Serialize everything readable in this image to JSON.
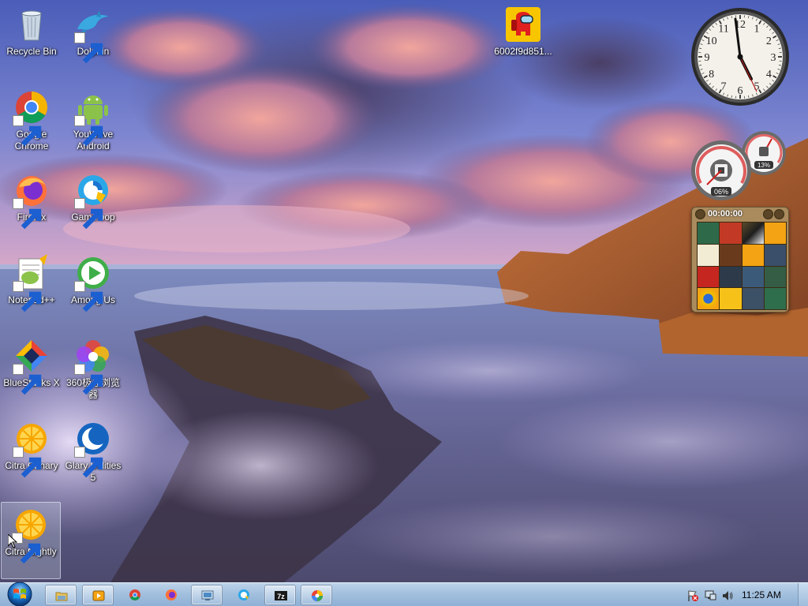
{
  "desktop": {
    "icons": [
      {
        "label": "Recycle Bin",
        "icon": "recycle-bin-icon",
        "shortcut": false
      },
      {
        "label": "Dolphin",
        "icon": "dolphin-icon",
        "shortcut": true
      },
      {
        "label": "6002f9d851...",
        "icon": "among-us-crewmate-icon",
        "shortcut": false
      },
      {
        "label": "Google Chrome",
        "icon": "chrome-icon",
        "shortcut": true
      },
      {
        "label": "YouWave Android",
        "icon": "android-icon",
        "shortcut": true
      },
      {
        "label": "Firefox",
        "icon": "firefox-icon",
        "shortcut": true
      },
      {
        "label": "Gameloop",
        "icon": "gameloop-icon",
        "shortcut": true
      },
      {
        "label": "Notepad++",
        "icon": "notepadpp-icon",
        "shortcut": true
      },
      {
        "label": "Among Us",
        "icon": "among-us-icon",
        "shortcut": true
      },
      {
        "label": "BlueStacks X",
        "icon": "bluestacks-icon",
        "shortcut": true
      },
      {
        "label": "360极速浏览器",
        "icon": "browser-360-icon",
        "shortcut": true
      },
      {
        "label": "Citra Canary",
        "icon": "citra-icon",
        "shortcut": true
      },
      {
        "label": "Glary Utilities 5",
        "icon": "glary-icon",
        "shortcut": true
      },
      {
        "label": "Citra Nightly",
        "icon": "citra-icon",
        "shortcut": true,
        "selected": true
      }
    ]
  },
  "gadgets": {
    "clock": {
      "hour_numerals": [
        "12",
        "1",
        "2",
        "3",
        "4",
        "5",
        "6",
        "7",
        "8",
        "9",
        "10",
        "11"
      ]
    },
    "meter": {
      "cpu": "06%",
      "memory": "13%"
    },
    "puzzle": {
      "timer": "00:00:00"
    }
  },
  "taskbar": {
    "items": [
      {
        "name": "explorer-icon"
      },
      {
        "name": "media-player-icon"
      },
      {
        "name": "chrome-icon"
      },
      {
        "name": "firefox-icon"
      },
      {
        "name": "remote-desktop-icon"
      },
      {
        "name": "gameloop-icon"
      },
      {
        "name": "7zip-icon",
        "text": "7z"
      },
      {
        "name": "360-browser-icon"
      }
    ],
    "clock": "11:25 AM"
  },
  "colors": {
    "taskbar": "#a3c0de",
    "sky": "#5a6fc0",
    "sea": "#6a6fa3"
  }
}
